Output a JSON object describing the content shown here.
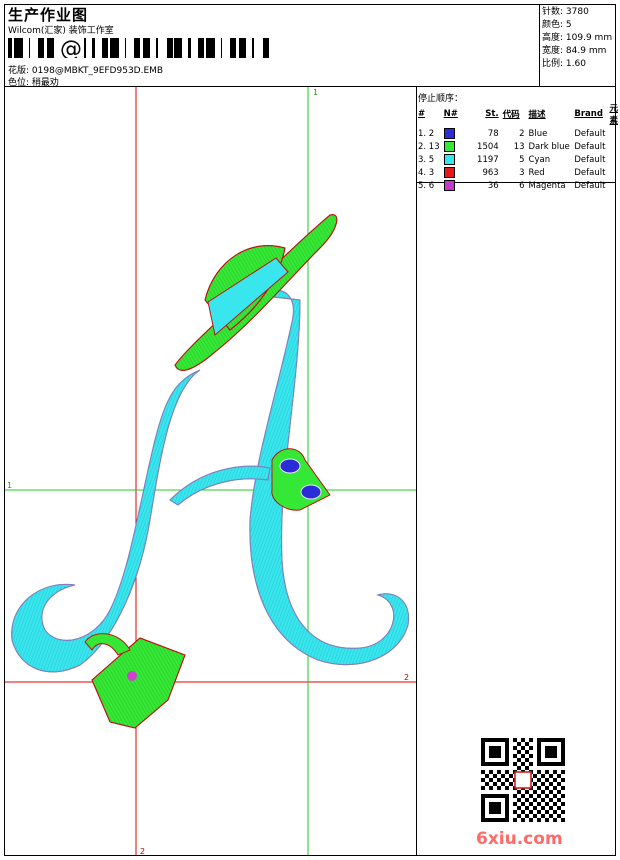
{
  "header": {
    "title": "生产作业图",
    "company": "Wilcom(汇家) 装饰工作室",
    "design_label": "花版:",
    "design_value": "0198@MBKT_9EFD953D.EMB",
    "colorway_label": "色位:",
    "colorway_value": "稍最劝"
  },
  "stats": {
    "stitches_label": "针数:",
    "stitches_value": "3780",
    "colors_label": "颜色:",
    "colors_value": "5",
    "height_label": "高度:",
    "height_value": "109.9 mm",
    "width_label": "宽度:",
    "width_value": "84.9 mm",
    "scale_label": "比例:",
    "scale_value": "1.60"
  },
  "stop_sequence": {
    "title": "停止顺序：",
    "headers": [
      "#",
      "N#",
      "St.",
      "代码",
      "描述",
      "Brand",
      "元素"
    ],
    "rows": [
      {
        "seq": "1. 2",
        "swatch": "#2b2bd8",
        "st": "78",
        "code": "2",
        "desc": "Blue",
        "brand": "Default"
      },
      {
        "seq": "2. 13",
        "swatch": "#36e836",
        "st": "1504",
        "code": "13",
        "desc": "Dark blue",
        "brand": "Default"
      },
      {
        "seq": "3. 5",
        "swatch": "#36e6ee",
        "st": "1197",
        "code": "5",
        "desc": "Cyan",
        "brand": "Default"
      },
      {
        "seq": "4. 3",
        "swatch": "#e81818",
        "st": "963",
        "code": "3",
        "desc": "Red",
        "brand": "Default"
      },
      {
        "seq": "5. 6",
        "swatch": "#c23acc",
        "st": "36",
        "code": "6",
        "desc": "Magenta",
        "brand": "Default"
      }
    ]
  },
  "guides": {
    "top_label": "1",
    "left_label": "1",
    "right_label": "2",
    "bottom_label": "2"
  },
  "watermark": "6xiu.com",
  "icons": {
    "barcode": "barcode-icon",
    "qr": "qr-code-icon"
  }
}
